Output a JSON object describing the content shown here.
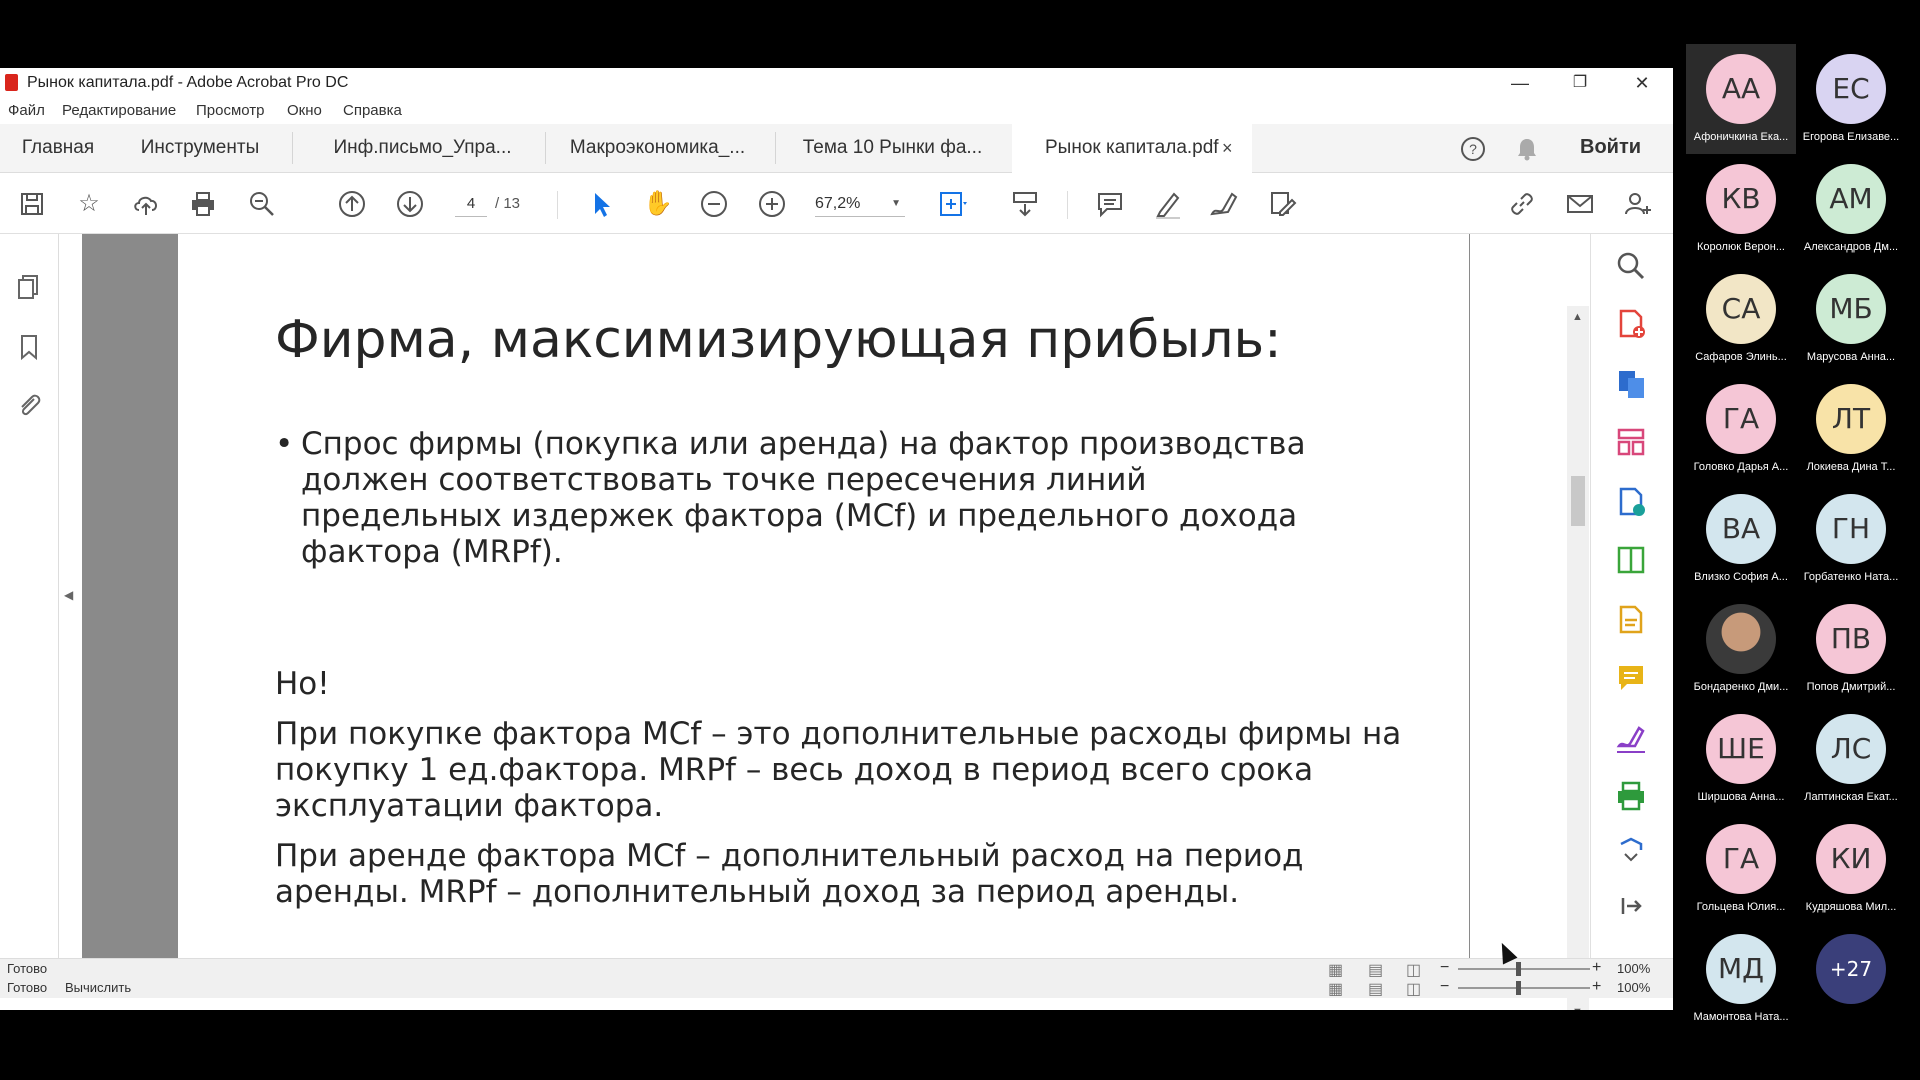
{
  "window": {
    "title": "Рынок капитала.pdf - Adobe Acrobat Pro DC",
    "minimize": "—",
    "restore": "❐",
    "close": "✕"
  },
  "menu": [
    "Файл",
    "Редактирование",
    "Просмотр",
    "Окно",
    "Справка"
  ],
  "tabs": {
    "home": "Главная",
    "tools": "Инструменты",
    "docs": [
      "Инф.письмо_Упра...",
      "Макроэкономика_...",
      "Тема 10 Рынки фа...",
      "Рынок капитала.pdf"
    ],
    "close_glyph": "×",
    "login": "Войти"
  },
  "toolbar": {
    "page_current": "4",
    "page_total": "/ 13",
    "zoom": "67,2%"
  },
  "slide": {
    "title": "Фирма, максимизирующая прибыль:",
    "bullet_glyph": "•",
    "bullet": "Спрос фирмы (покупка или аренда) на фактор производства должен соответствовать точке пересечения линий предельных издержек фактора (MCf) и предельного дохода фактора (MRPf).",
    "no": "Но!",
    "para1": "При покупке фактора MCf – это дополнительные расходы фирмы на покупку 1 ед.фактора. MRPf – весь доход в период всего срока эксплуатации фактора.",
    "para2": "При аренде фактора MCf – дополнительный расход на период аренды. MRPf – дополнительный доход за период аренды."
  },
  "status": {
    "ready": "Готово",
    "ready2": "Готово",
    "calc": "Вычислить",
    "zoom": "100%",
    "zoom2": "100%",
    "minus": "−",
    "plus": "+"
  },
  "participants": [
    {
      "initials": "АА",
      "name": "Афоничкина Ека...",
      "color": "#f5c6d6"
    },
    {
      "initials": "ЕС",
      "name": "Егорова Елизаве...",
      "color": "#d9d4f2"
    },
    {
      "initials": "КВ",
      "name": "Королюк Верон...",
      "color": "#f5c6d6"
    },
    {
      "initials": "АМ",
      "name": "Александров Дм...",
      "color": "#cdebd4"
    },
    {
      "initials": "СА",
      "name": "Сафаров Элинь...",
      "color": "#f2e6c6"
    },
    {
      "initials": "МБ",
      "name": "Марусова Анна...",
      "color": "#cdebd4"
    },
    {
      "initials": "ГА",
      "name": "Головко Дарья А...",
      "color": "#f5c6d6"
    },
    {
      "initials": "ЛТ",
      "name": "Локиева Дина Т...",
      "color": "#f8e3a8"
    },
    {
      "initials": "ВА",
      "name": "Влизко София А...",
      "color": "#d3e6ee"
    },
    {
      "initials": "ГН",
      "name": "Горбатенко Ната...",
      "color": "#d3e6ee"
    },
    {
      "initials": "",
      "name": "Бондаренко Дми...",
      "color": "#444444"
    },
    {
      "initials": "ПВ",
      "name": "Попов Дмитрий...",
      "color": "#f5c6d6"
    },
    {
      "initials": "ШЕ",
      "name": "Ширшова Анна...",
      "color": "#f5c6d6"
    },
    {
      "initials": "ЛС",
      "name": "Лаптинская Екат...",
      "color": "#d3e6ee"
    },
    {
      "initials": "ГА",
      "name": "Гольцева Юлия...",
      "color": "#f5c6d6"
    },
    {
      "initials": "КИ",
      "name": "Кудряшова Мил...",
      "color": "#f5c6d6"
    },
    {
      "initials": "МД",
      "name": "Мамонтова Ната...",
      "color": "#d3e6ee"
    },
    {
      "initials": "+27",
      "name": "",
      "color": "#3a3f7a"
    }
  ]
}
